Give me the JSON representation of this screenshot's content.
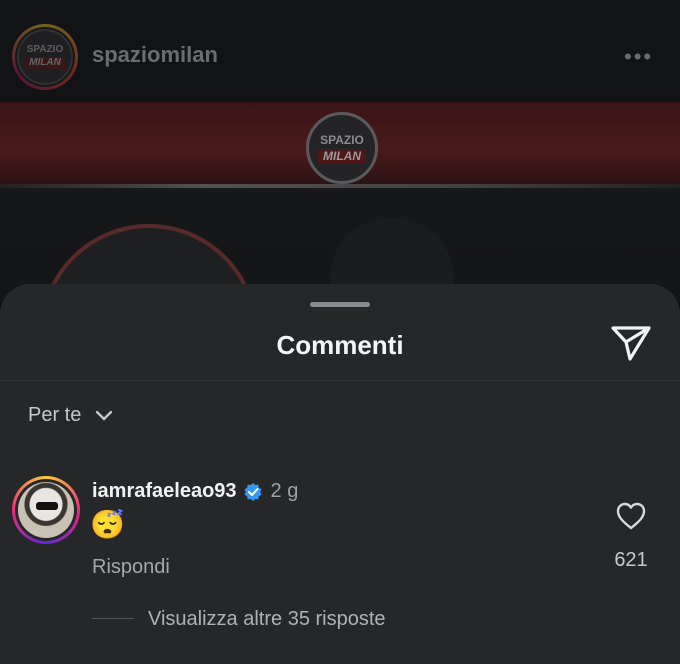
{
  "post": {
    "username": "spaziomilan",
    "more_glyph": "•••",
    "logo_line1": "SPAZIO",
    "logo_line2": "MILAN",
    "band_logo_line1": "SPAZIO",
    "band_logo_line2": "MILAN"
  },
  "sheet": {
    "title": "Commenti",
    "filter_label": "Per te",
    "share_icon": "paper-plane-icon"
  },
  "comment": {
    "username": "iamrafaeleao93",
    "time": "2 g",
    "text": "😴",
    "reply_label": "Rispondi",
    "likes": "621",
    "more_replies": "Visualizza altre 35 risposte"
  },
  "colors": {
    "sheet_bg": "#262729",
    "verified_blue": "#3897f0",
    "band_red": "#4a1a1b"
  }
}
